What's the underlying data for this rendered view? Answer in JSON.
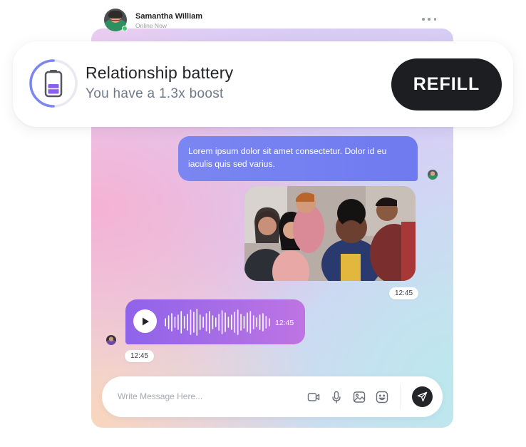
{
  "header": {
    "contact_name": "Samantha William",
    "status": "Online Now",
    "more_icon": "more-horizontal-icon"
  },
  "battery_card": {
    "title": "Relationship battery",
    "subtitle": "You have a 1.3x boost",
    "level_fraction": 0.5,
    "refill_label": "REFILL",
    "colors": {
      "ring": "#7b86f2",
      "battery_fill": "#8a5ef0",
      "button_bg": "#1d1e22"
    }
  },
  "messages": {
    "outgoing_text": "Lorem ipsum dolor sit amet consectetur. Dolor id eu iaculis quis sed varius.",
    "photo_timestamp": "12:45",
    "voice_duration": "12:45",
    "voice_timestamp": "12:45"
  },
  "composer": {
    "placeholder": "Write Message Here...",
    "icons": [
      "video-icon",
      "mic-icon",
      "image-icon",
      "emoji-icon",
      "send-icon"
    ]
  },
  "colors": {
    "accent": "#6f7af0",
    "voice_gradient_start": "#8f63ea",
    "voice_gradient_end": "#bf74e2"
  }
}
